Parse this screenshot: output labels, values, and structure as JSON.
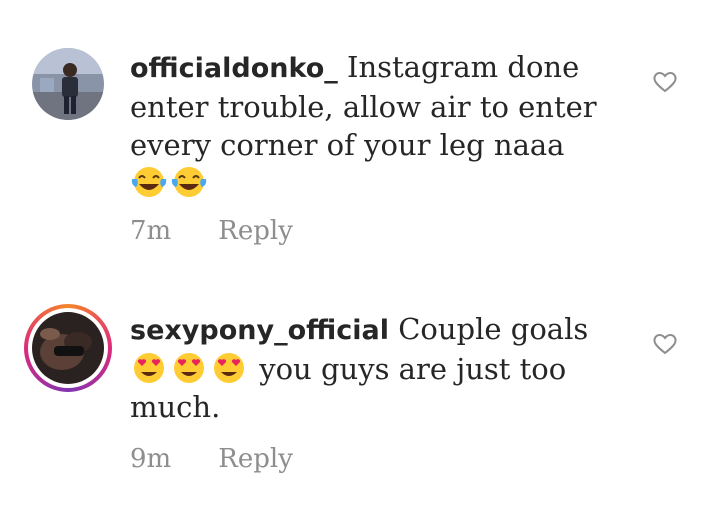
{
  "comments": [
    {
      "username": "officialdonko_",
      "text": "Instagram done enter trouble, allow air to enter every corner of your leg naaa",
      "emoji": [
        "laughing-tears",
        "laughing-tears"
      ],
      "time": "7m",
      "reply_label": "Reply",
      "icons": {
        "like": "heart-outline-icon"
      }
    },
    {
      "username": "sexypony_official",
      "text_before_emoji": "Couple goals",
      "emoji": [
        "heart-eyes",
        "heart-eyes",
        "heart-eyes"
      ],
      "text_after_emoji": "you guys are just too much.",
      "time": "9m",
      "reply_label": "Reply",
      "has_story_ring": true,
      "icons": {
        "like": "heart-outline-icon"
      }
    }
  ],
  "colors": {
    "text": "#262626",
    "meta": "#8e8e8e",
    "story_ring": [
      "#f58529",
      "#dd2a7b",
      "#8134af"
    ]
  }
}
